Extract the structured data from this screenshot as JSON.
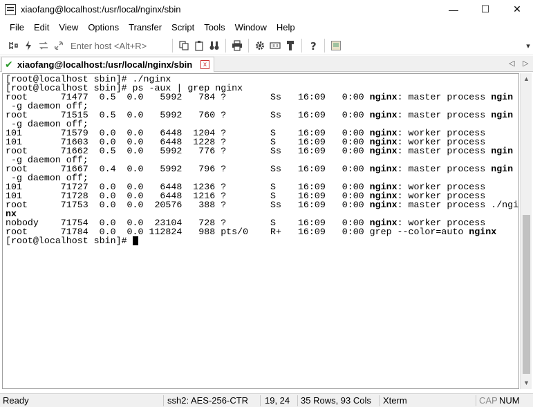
{
  "window": {
    "title": "xiaofang@localhost:/usr/local/nginx/sbin",
    "app_icon": "securecrt-terminal-icon",
    "controls": {
      "minimize": "—",
      "maximize": "☐",
      "close": "✕"
    }
  },
  "menu": [
    "File",
    "Edit",
    "View",
    "Options",
    "Transfer",
    "Script",
    "Tools",
    "Window",
    "Help"
  ],
  "toolbar": {
    "enter_host_placeholder": "Enter host <Alt+R>",
    "icons": [
      "connect-icon",
      "quick-connect-icon",
      "reconnect-icon",
      "disconnect-icon",
      "copy-icon",
      "paste-icon",
      "find-icon",
      "print-icon",
      "settings-icon",
      "keymap-icon",
      "sftp-icon",
      "help-icon",
      "screenshot-icon"
    ]
  },
  "tab": {
    "label": "xiaofang@localhost:/usr/local/nginx/sbin",
    "close": "x",
    "scroll_left": "◁",
    "scroll_right": "▷"
  },
  "terminal": {
    "lines": [
      [
        {
          "t": "[root@localhost sbin]# ./nginx"
        }
      ],
      [
        {
          "t": "[root@localhost sbin]# ps -aux | grep nginx"
        }
      ],
      [
        {
          "t": "root      71477  0.5  0.0   5992   784 ?        Ss   16:09   0:00 "
        },
        {
          "t": "nginx",
          "b": true
        },
        {
          "t": ": master process "
        },
        {
          "t": "ngin",
          "b": true
        }
      ],
      [
        {
          "t": " -g daemon off;"
        }
      ],
      [
        {
          "t": "root      71515  0.5  0.0   5992   760 ?        Ss   16:09   0:00 "
        },
        {
          "t": "nginx",
          "b": true
        },
        {
          "t": ": master process "
        },
        {
          "t": "ngin",
          "b": true
        }
      ],
      [
        {
          "t": " -g daemon off;"
        }
      ],
      [
        {
          "t": "101       71579  0.0  0.0   6448  1204 ?        S    16:09   0:00 "
        },
        {
          "t": "nginx",
          "b": true
        },
        {
          "t": ": worker process"
        }
      ],
      [
        {
          "t": "101       71603  0.0  0.0   6448  1228 ?        S    16:09   0:00 "
        },
        {
          "t": "nginx",
          "b": true
        },
        {
          "t": ": worker process"
        }
      ],
      [
        {
          "t": "root      71662  0.5  0.0   5992   776 ?        Ss   16:09   0:00 "
        },
        {
          "t": "nginx",
          "b": true
        },
        {
          "t": ": master process "
        },
        {
          "t": "ngin",
          "b": true
        }
      ],
      [
        {
          "t": " -g daemon off;"
        }
      ],
      [
        {
          "t": "root      71667  0.4  0.0   5992   796 ?        Ss   16:09   0:00 "
        },
        {
          "t": "nginx",
          "b": true
        },
        {
          "t": ": master process "
        },
        {
          "t": "ngin",
          "b": true
        }
      ],
      [
        {
          "t": " -g daemon off;"
        }
      ],
      [
        {
          "t": "101       71727  0.0  0.0   6448  1236 ?        S    16:09   0:00 "
        },
        {
          "t": "nginx",
          "b": true
        },
        {
          "t": ": worker process"
        }
      ],
      [
        {
          "t": "101       71728  0.0  0.0   6448  1216 ?        S    16:09   0:00 "
        },
        {
          "t": "nginx",
          "b": true
        },
        {
          "t": ": worker process"
        }
      ],
      [
        {
          "t": "root      71753  0.0  0.0  20576   388 ?        Ss   16:09   0:00 "
        },
        {
          "t": "nginx",
          "b": true
        },
        {
          "t": ": master process ./ngi"
        }
      ],
      [
        {
          "t": "nx",
          "b": true
        }
      ],
      [
        {
          "t": "nobody    71754  0.0  0.0  23104   728 ?        S    16:09   0:00 "
        },
        {
          "t": "nginx",
          "b": true
        },
        {
          "t": ": worker process"
        }
      ],
      [
        {
          "t": "root      71784  0.0  0.0 112824   988 pts/0    R+   16:09   0:00 grep --color=auto "
        },
        {
          "t": "nginx",
          "b": true
        }
      ],
      [
        {
          "t": "[root@localhost sbin]# "
        },
        {
          "cursor": true
        }
      ]
    ]
  },
  "scrollbar": {
    "up": "▲",
    "down": "▼"
  },
  "status": {
    "ready": "Ready",
    "protocol": "ssh2: AES-256-CTR",
    "cursor_pos": "19,  24",
    "size": "35 Rows, 93 Cols",
    "emulation": "Xterm",
    "cap": "CAP",
    "num": "NUM"
  },
  "colors": {
    "tab_check": "#2d9a2d",
    "close_red": "#cc3333",
    "chrome": "#f0f0f0"
  }
}
